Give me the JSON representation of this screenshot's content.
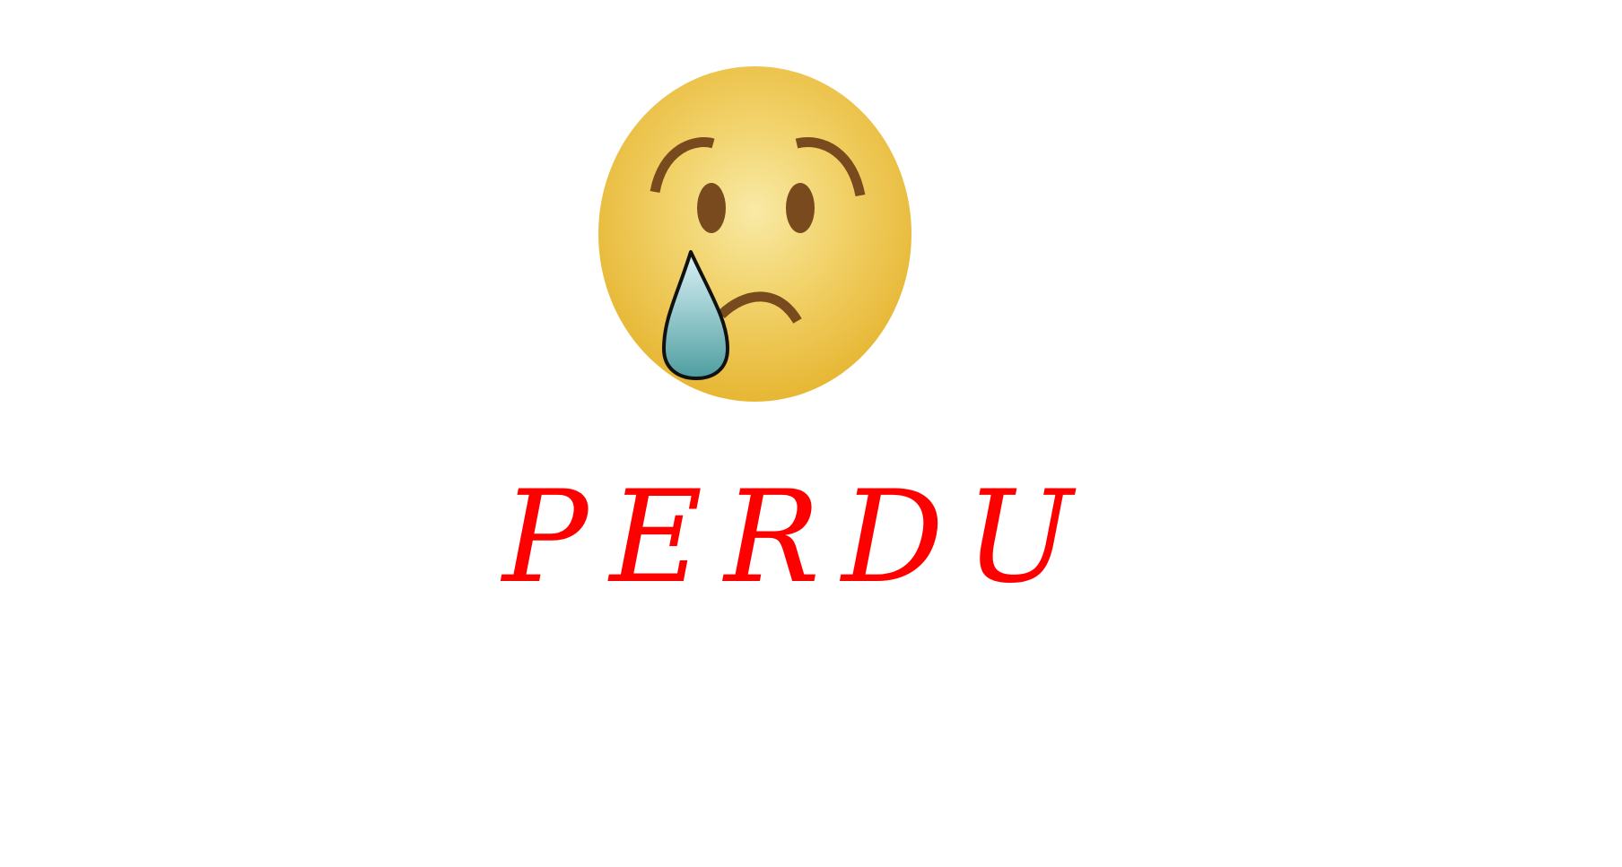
{
  "game_over": {
    "result_text": "PERDU",
    "emoji_icon": "crying-face-icon"
  },
  "colors": {
    "background": "#ffffff",
    "result_text": "#ff0000",
    "face_yellow": "#e6b32d",
    "face_highlight": "#f6e69c",
    "feature_brown": "#784a1d",
    "tear_top": "#b8dee8",
    "tear_bottom": "#4e9d9f"
  }
}
